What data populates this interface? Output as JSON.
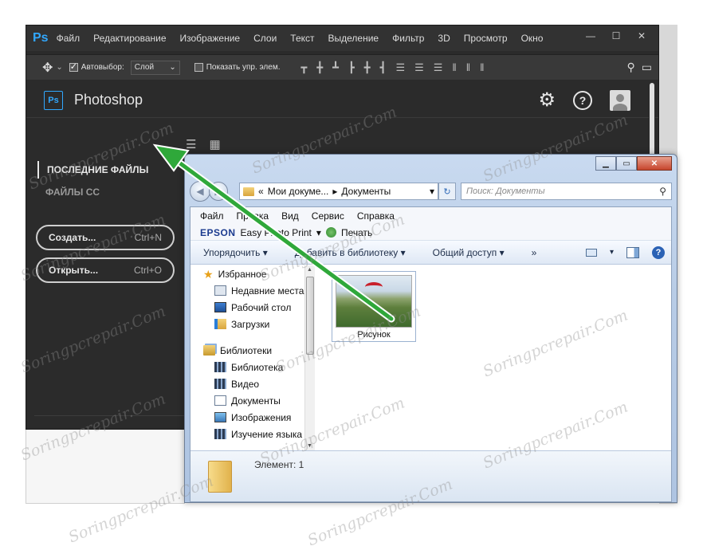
{
  "photoshop": {
    "logo": "Ps",
    "menu": [
      "Файл",
      "Редактирование",
      "Изображение",
      "Слои",
      "Текст",
      "Выделение",
      "Фильтр",
      "3D",
      "Просмотр",
      "Окно"
    ],
    "window_buttons": [
      "—",
      "☐",
      "✕"
    ],
    "options": {
      "autoselect_label": "Автовыбор:",
      "autoselect_value": "Слой",
      "show_controls_label": "Показать упр. элем."
    },
    "home": {
      "title": "Photoshop",
      "nav_recent": "ПОСЛЕДНИЕ ФАЙЛЫ",
      "nav_cc": "ФАЙЛЫ CC",
      "create_label": "Создать...",
      "create_shortcut": "Ctrl+N",
      "open_label": "Открыть...",
      "open_shortcut": "Ctrl+O"
    }
  },
  "explorer": {
    "caption_buttons": [
      "▁",
      "▭",
      "✕"
    ],
    "address": {
      "prefix": "«",
      "segment1": "Мои докуме...",
      "separator": "▸",
      "segment2": "Документы"
    },
    "search_placeholder": "Поиск: Документы",
    "menu": [
      "Файл",
      "Правка",
      "Вид",
      "Сервис",
      "Справка"
    ],
    "epson": {
      "logo": "EPSON",
      "easy_print": "Easy Photo Print",
      "print": "Печать"
    },
    "commands": {
      "organize": "Упорядочить ▾",
      "add_library": "Добавить в библиотеку ▾",
      "share": "Общий доступ ▾",
      "more": "»"
    },
    "tree": {
      "favorites": "Избранное",
      "recent": "Недавние места",
      "desktop": "Рабочий стол",
      "downloads": "Загрузки",
      "libraries": "Библиотеки",
      "library": "Библиотека",
      "video": "Видео",
      "documents": "Документы",
      "images": "Изображения",
      "language": "Изучение языка"
    },
    "file_name": "Рисунок",
    "status": "Элемент: 1"
  },
  "watermark": "Soringpcrepair.Com",
  "colors": {
    "ps_blue": "#31a8ff",
    "arrow_green": "#2fa83a"
  }
}
